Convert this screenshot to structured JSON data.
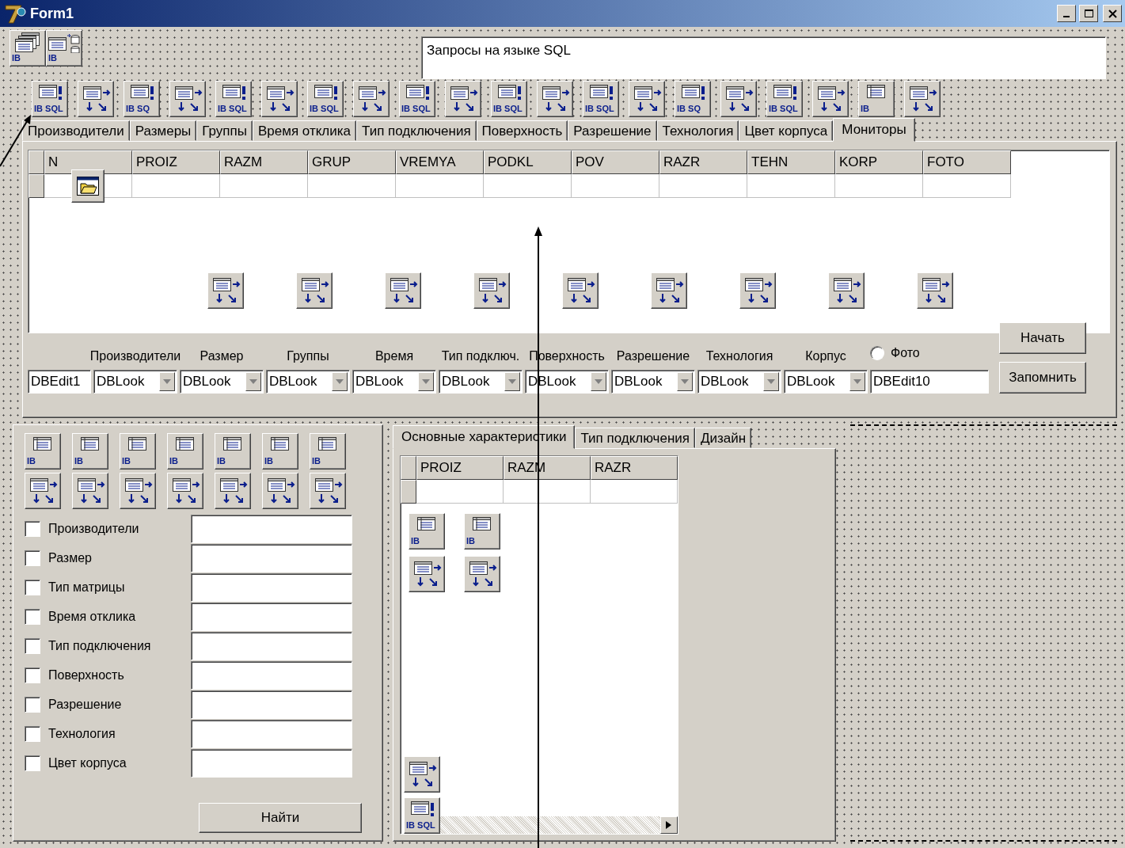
{
  "window": {
    "title": "Form1"
  },
  "top_components": [
    {
      "kind": "ibdatabase",
      "caption": "IB"
    },
    {
      "kind": "ibtransaction",
      "caption": "IB"
    }
  ],
  "memo": {
    "text": "Запросы на языке SQL"
  },
  "tab_components": [
    {
      "kind": "ibquery",
      "caption": "IB SQL"
    },
    {
      "kind": "datasource"
    },
    {
      "kind": "ibquery",
      "caption": "IB SQ"
    },
    {
      "kind": "datasource"
    },
    {
      "kind": "ibquery",
      "caption": "IB SQL"
    },
    {
      "kind": "datasource"
    },
    {
      "kind": "ibquery",
      "caption": "IB SQL"
    },
    {
      "kind": "datasource"
    },
    {
      "kind": "ibquery",
      "caption": "IB SQL"
    },
    {
      "kind": "datasource"
    },
    {
      "kind": "ibquery",
      "caption": "IB SQL"
    },
    {
      "kind": "datasource"
    },
    {
      "kind": "ibquery",
      "caption": "IB SQL"
    },
    {
      "kind": "datasource"
    },
    {
      "kind": "ibquery",
      "caption": "IB SQ"
    },
    {
      "kind": "datasource"
    },
    {
      "kind": "ibquery",
      "caption": "IB SQL"
    },
    {
      "kind": "datasource"
    },
    {
      "kind": "ibtable",
      "caption": "IB"
    },
    {
      "kind": "datasource"
    }
  ],
  "tabs": [
    {
      "label": "Производители",
      "selected": false
    },
    {
      "label": "Размеры",
      "selected": false
    },
    {
      "label": "Группы",
      "selected": false
    },
    {
      "label": "Время отклика",
      "selected": false
    },
    {
      "label": "Тип подключения",
      "selected": false
    },
    {
      "label": "Поверхность",
      "selected": false
    },
    {
      "label": "Разрешение",
      "selected": false
    },
    {
      "label": "Технология",
      "selected": false
    },
    {
      "label": "Цвет корпуса",
      "selected": false
    },
    {
      "label": "Мониторы",
      "selected": true
    }
  ],
  "grid": {
    "columns": [
      "N",
      "PROIZ",
      "RAZM",
      "GRUP",
      "VREMYA",
      "PODKL",
      "POV",
      "RAZR",
      "TEHN",
      "KORP",
      "FOTO"
    ],
    "components": [
      {
        "kind": "datasource"
      },
      {
        "kind": "datasource"
      },
      {
        "kind": "datasource"
      },
      {
        "kind": "datasource"
      },
      {
        "kind": "datasource"
      },
      {
        "kind": "datasource"
      },
      {
        "kind": "datasource"
      },
      {
        "kind": "datasource"
      },
      {
        "kind": "datasource"
      }
    ]
  },
  "edit_first": {
    "value": "DBEdit1"
  },
  "lookups": [
    {
      "label": "Производители",
      "value": "DBLook"
    },
    {
      "label": "Размер",
      "value": "DBLook"
    },
    {
      "label": "Группы",
      "value": "DBLook"
    },
    {
      "label": "Время",
      "value": "DBLook"
    },
    {
      "label": "Тип подключ.",
      "value": "DBLook"
    },
    {
      "label": "Поверхность",
      "value": "DBLook"
    },
    {
      "label": "Разрешение",
      "value": "DBLook"
    },
    {
      "label": "Технология",
      "value": "DBLook"
    },
    {
      "label": "Корпус",
      "value": "DBLook"
    }
  ],
  "photo_radio": {
    "label": "Фото",
    "selected": false
  },
  "edit_last": {
    "value": "DBEdit10"
  },
  "buttons": [
    "Начать",
    "Запомнить"
  ],
  "search_panel": {
    "components": [
      {
        "kind": "ibtable",
        "caption": "IB"
      },
      {
        "kind": "ibtable",
        "caption": "IB"
      },
      {
        "kind": "ibtable",
        "caption": "IB"
      },
      {
        "kind": "ibtable",
        "caption": "IB"
      },
      {
        "kind": "ibtable",
        "caption": "IB"
      },
      {
        "kind": "ibtable",
        "caption": "IB"
      },
      {
        "kind": "ibtable",
        "caption": "IB"
      },
      {
        "kind": "datasource"
      },
      {
        "kind": "datasource"
      },
      {
        "kind": "datasource"
      },
      {
        "kind": "datasource"
      },
      {
        "kind": "datasource"
      },
      {
        "kind": "datasource"
      },
      {
        "kind": "datasource"
      }
    ],
    "filters": [
      {
        "label": "Производители",
        "checked": false
      },
      {
        "label": "Размер",
        "checked": false
      },
      {
        "label": "Тип матрицы",
        "checked": false
      },
      {
        "label": "Время отклика",
        "checked": false
      },
      {
        "label": "Тип подключения",
        "checked": false
      },
      {
        "label": "Поверхность",
        "checked": false
      },
      {
        "label": "Разрешение",
        "checked": false
      },
      {
        "label": "Технология",
        "checked": false
      },
      {
        "label": "Цвет корпуса",
        "checked": false
      }
    ],
    "find_button": "Найти"
  },
  "detail": {
    "tabs": [
      {
        "label": "Основные характеристики",
        "selected": true
      },
      {
        "label": "Тип подключения",
        "selected": false
      },
      {
        "label": "Дизайн",
        "selected": false
      }
    ],
    "columns": [
      "PROIZ",
      "RAZM",
      "RAZR"
    ],
    "components": [
      {
        "kind": "ibtable",
        "caption": "IB"
      },
      {
        "kind": "ibtable",
        "caption": "IB"
      },
      {
        "kind": "datasource"
      },
      {
        "kind": "datasource"
      }
    ],
    "bottom_components": [
      {
        "kind": "datasource"
      },
      {
        "kind": "ibquery",
        "caption": "IB SQL"
      }
    ]
  }
}
